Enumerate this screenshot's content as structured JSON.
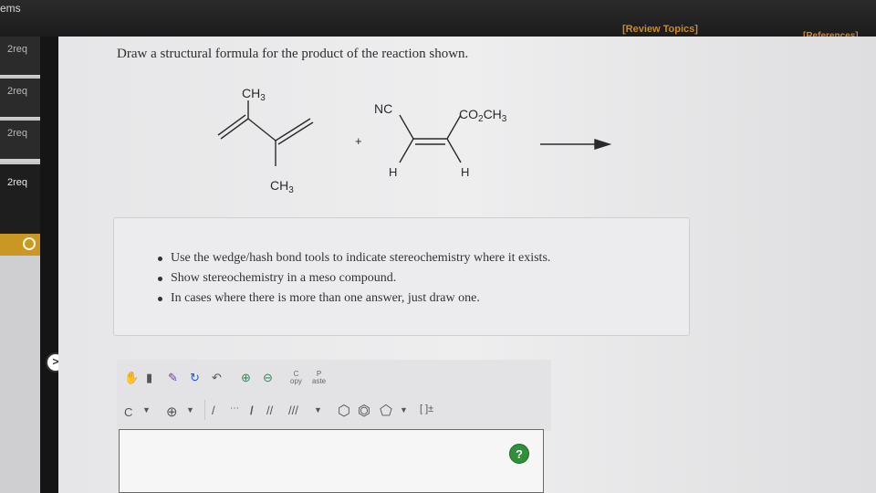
{
  "header": {
    "items_label": "ems",
    "review_topics": "[Review Topics]",
    "references": "[References]"
  },
  "sidebar": {
    "items": [
      {
        "label": "2req"
      },
      {
        "label": "2req"
      },
      {
        "label": "2req"
      },
      {
        "label": "2req"
      }
    ]
  },
  "question": {
    "prompt": "Draw a structural formula for the product of the reaction shown."
  },
  "reaction": {
    "diene_top_label": "CH3",
    "diene_bottom_label": "CH3",
    "plus": "+",
    "dienophile_nc": "NC",
    "dienophile_ester": "CO2CH3",
    "dienophile_h_left": "H",
    "dienophile_h_right": "H"
  },
  "instructions": [
    "Use the wedge/hash bond tools to indicate stereochemistry where it exists.",
    "Show stereochemistry in a meso compound.",
    "In cases where there is more than one answer, just draw one."
  ],
  "toolbar": {
    "copy_label": "C\nopy",
    "paste_label": "P\naste",
    "element_label": "C",
    "bracket_label": "[ ]±"
  },
  "help": "?"
}
